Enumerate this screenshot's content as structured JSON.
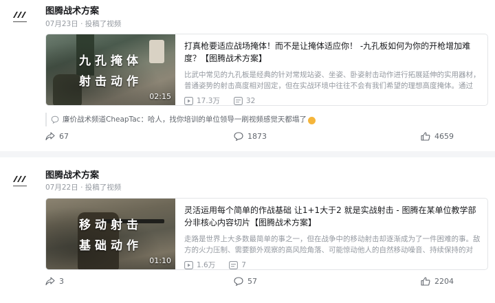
{
  "colors": {
    "meta": "#9499a0",
    "divider": "#f4f5f7",
    "border": "#e3e5e7"
  },
  "posts": [
    {
      "author": "图腾战术方案",
      "date": "07月23日",
      "action": "投稿了视频",
      "video": {
        "thumb_line1": "九孔掩体",
        "thumb_line2": "射击动作",
        "duration": "02:15",
        "title": "打真枪要适应战场掩体！而不是让掩体适应你！ -九孔板如何为你的开枪增加难度？【图腾战术方案】",
        "desc": "比武中常见的九孔板是经典的针对常规站姿、坐姿、卧姿射击动作进行拓展延伸的实用器材，普通姿势的射击高度相对固定，但在实战环境中往往不会有我们希望的理想高度掩体。通过",
        "plays": "17.3万",
        "danmaku": "32"
      },
      "comment": {
        "user": "廉价战术频道CheapTac",
        "text": "：哈人，找你培训的单位领导一刷视频感觉天都塌了",
        "emoji": "sweat-smile-emoji"
      },
      "forwards": "67",
      "replies": "1873",
      "likes": "4659"
    },
    {
      "author": "图腾战术方案",
      "date": "07月22日",
      "action": "投稿了视频",
      "video": {
        "thumb_line1": "移动射击",
        "thumb_line2": "基础动作",
        "duration": "01:10",
        "title": "灵活运用每个简单的作战基础 让1+1大于2 就是实战射击 - 图腾在某单位教学部分非核心内容切片【图腾战术方案】",
        "desc": "走路是世界上大多数最简单的事之一，但在战争中的移动射击却逐渐成为了一件困难的事。敌方的火力压制、需要额外观察的高风险角落、可能惊动他人的自然移动噪音、持续保持的对",
        "plays": "1.6万",
        "danmaku": "7"
      },
      "forwards": "3",
      "replies": "57",
      "likes": "2204"
    }
  ]
}
